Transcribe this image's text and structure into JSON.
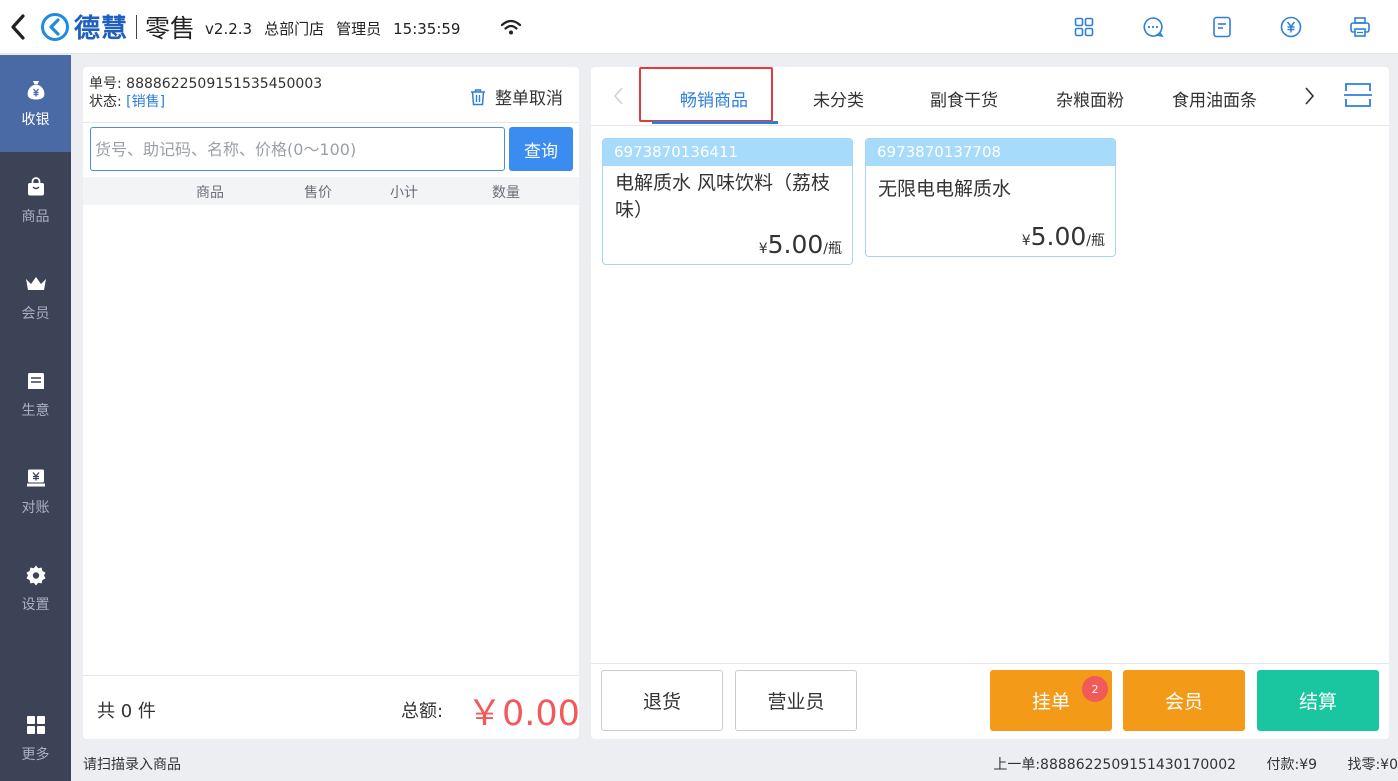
{
  "header": {
    "brand": "德慧",
    "product": "零售",
    "version": "v2.2.3",
    "store": "总部门店",
    "role": "管理员",
    "time": "15:35:59",
    "icons": [
      "grid-icon",
      "chat-icon",
      "document-icon",
      "yuan-icon",
      "printer-icon"
    ]
  },
  "sidebar": {
    "items": [
      {
        "label": "收银",
        "icon": "money-bag-icon",
        "active": true
      },
      {
        "label": "商品",
        "icon": "bag-icon"
      },
      {
        "label": "会员",
        "icon": "crown-icon"
      },
      {
        "label": "生意",
        "icon": "ledger-icon"
      },
      {
        "label": "对账",
        "icon": "yuan-box-icon"
      },
      {
        "label": "设置",
        "icon": "gear-icon"
      }
    ],
    "more_label": "更多"
  },
  "order": {
    "number_label": "单号:",
    "number": "8888622509151535450003",
    "status_label": "状态:",
    "status": "[销售]",
    "cancel_label": "整单取消",
    "search_placeholder": "货号、助记码、名称、价格(0～100)",
    "query_label": "查询",
    "columns": [
      "商品",
      "售价",
      "小计",
      "数量"
    ],
    "count_text": "共 0 件",
    "total_label": "总额:",
    "total_value": "￥0.00"
  },
  "categories": {
    "tabs": [
      "畅销商品",
      "未分类",
      "副食干货",
      "杂粮面粉",
      "食用油面条"
    ],
    "active_index": 0
  },
  "products": [
    {
      "code": "6973870136411",
      "name": "电解质水 风味饮料（荔枝味）",
      "currency": "¥",
      "price": "5.00",
      "unit": "/瓶"
    },
    {
      "code": "6973870137708",
      "name": "无限电电解质水",
      "currency": "¥",
      "price": "5.00",
      "unit": "/瓶"
    }
  ],
  "actions": {
    "return_label": "退货",
    "salesperson_label": "营业员",
    "hold_label": "挂单",
    "hold_badge": "2",
    "member_label": "会员",
    "checkout_label": "结算"
  },
  "statusbar": {
    "hint": "请扫描录入商品",
    "last_order": "上一单:8888622509151430170002",
    "paid": "付款:¥9",
    "change": "找零:¥0"
  },
  "colors": {
    "accent_blue": "#2e7fd9",
    "sidebar_bg": "#3c4356",
    "sidebar_active": "#4a6aa5",
    "orange": "#f39a18",
    "teal": "#19c6a0",
    "price_red": "#f25a5a",
    "tab_highlight": "#e23b3b"
  }
}
